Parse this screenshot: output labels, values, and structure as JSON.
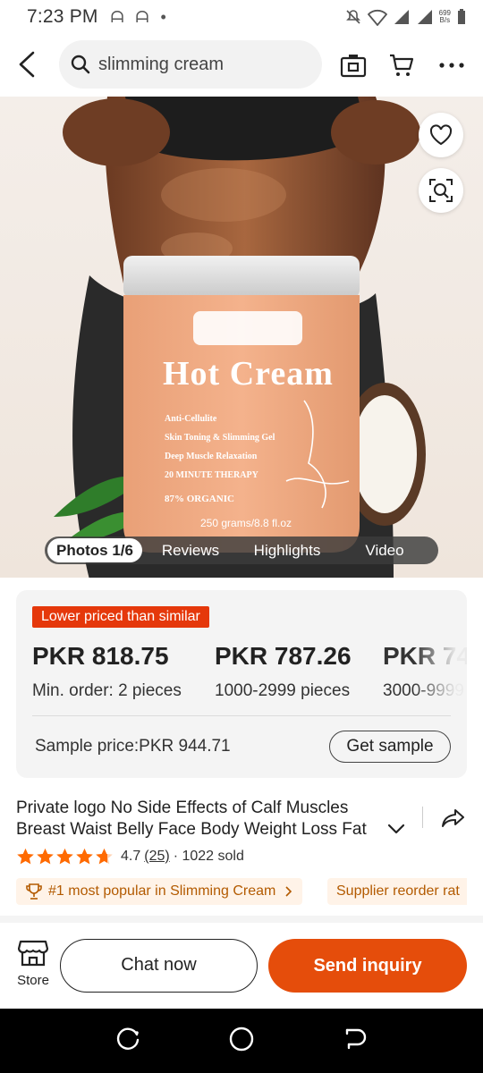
{
  "status_bar": {
    "time": "7:23 PM",
    "notifications": "ᗩ ᗩ •",
    "speed_top": "699",
    "speed_bottom": "B/s"
  },
  "search": {
    "query": "slimming cream"
  },
  "product_image": {
    "brand_text": "Hot Cream",
    "lines": [
      "Anti-Cellulite",
      "Skin Toning & Slimming Gel",
      "Deep Muscle Relaxation",
      "20 MINUTE THERAPY",
      "87% ORGANIC"
    ],
    "weight": "250 grams/8.8 fl.oz"
  },
  "media_tabs": [
    {
      "label": "Photos 1/6",
      "active": true
    },
    {
      "label": "Reviews",
      "active": false
    },
    {
      "label": "Highlights",
      "active": false
    },
    {
      "label": "Video",
      "active": false
    }
  ],
  "pricing": {
    "badge": "Lower priced than similar",
    "tiers": [
      {
        "price": "PKR 818.75",
        "qty": "Min. order: 2 pieces"
      },
      {
        "price": "PKR 787.26",
        "qty": "1000-2999 pieces"
      },
      {
        "price": "PKR 74",
        "qty": "3000-9999"
      }
    ],
    "sample_price": "Sample price:PKR 944.71",
    "get_sample_label": "Get sample"
  },
  "product": {
    "title": "Private logo No Side Effects of Calf Muscles Breast Waist Belly Face Body Weight Loss Fat",
    "rating": "4.7",
    "review_count": "(25)",
    "sold": "· 1022 sold",
    "rating_value": 4.7,
    "chips": [
      "#1 most popular in Slimming Cream",
      "Supplier reorder rat"
    ]
  },
  "actions": {
    "store_label": "Store",
    "chat_label": "Chat now",
    "inquiry_label": "Send inquiry"
  },
  "colors": {
    "accent": "#e54d0b",
    "badge": "#e5380b",
    "star": "#ff6a00"
  }
}
